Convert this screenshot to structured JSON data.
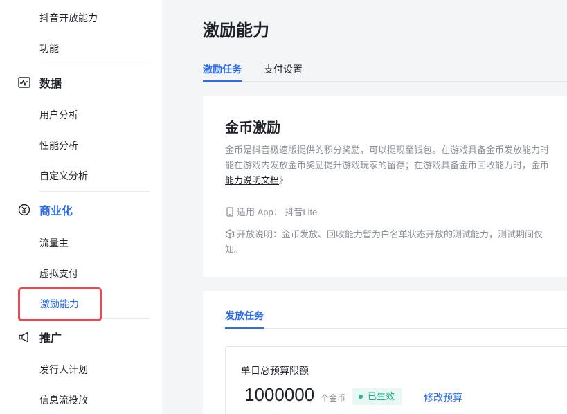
{
  "sidebar": {
    "items_top": [
      {
        "label": "抖音开放能力"
      },
      {
        "label": "功能"
      }
    ],
    "sections": [
      {
        "label": "数据",
        "icon": "chart-icon",
        "items": [
          {
            "label": "用户分析"
          },
          {
            "label": "性能分析"
          },
          {
            "label": "自定义分析"
          }
        ]
      },
      {
        "label": "商业化",
        "icon": "yuan-icon",
        "active": true,
        "items": [
          {
            "label": "流量主"
          },
          {
            "label": "虚拟支付"
          },
          {
            "label": "激励能力",
            "active": true
          }
        ]
      },
      {
        "label": "推广",
        "icon": "megaphone-icon",
        "items": [
          {
            "label": "发行人计划"
          },
          {
            "label": "信息流投放"
          }
        ]
      }
    ],
    "highlight_color": "#e8494f"
  },
  "main": {
    "title": "激励能力",
    "tabs": [
      {
        "label": "激励任务",
        "active": true
      },
      {
        "label": "支付设置"
      }
    ],
    "intro_card": {
      "title": "金币激励",
      "desc_lines": [
        "金币是抖音极速版提供的积分奖励，可以提现至钱包。在游戏具备金币发放能力时",
        "能在游戏内发放金币奖励提升游戏玩家的留存；在游戏具备金币回收能力时，金币"
      ],
      "doc_link": "能力说明文档",
      "doc_link_suffix": "》",
      "app_label": "适用 App：",
      "app_value": "抖音Lite",
      "notice_line1": "开放说明：金币发放、回收能力暂为白名单状态开放的测试能力，测试期间仅",
      "notice_line2": "知。"
    },
    "task_card": {
      "tab": "发放任务",
      "budget_label": "单日总预算限额",
      "budget_value": "1000000",
      "budget_unit": "个金币",
      "status": "已生效",
      "edit_label": "修改预算"
    }
  },
  "colors": {
    "accent": "#2b6cf3",
    "success": "#1ab28a",
    "muted_text": "#8a8f99"
  }
}
